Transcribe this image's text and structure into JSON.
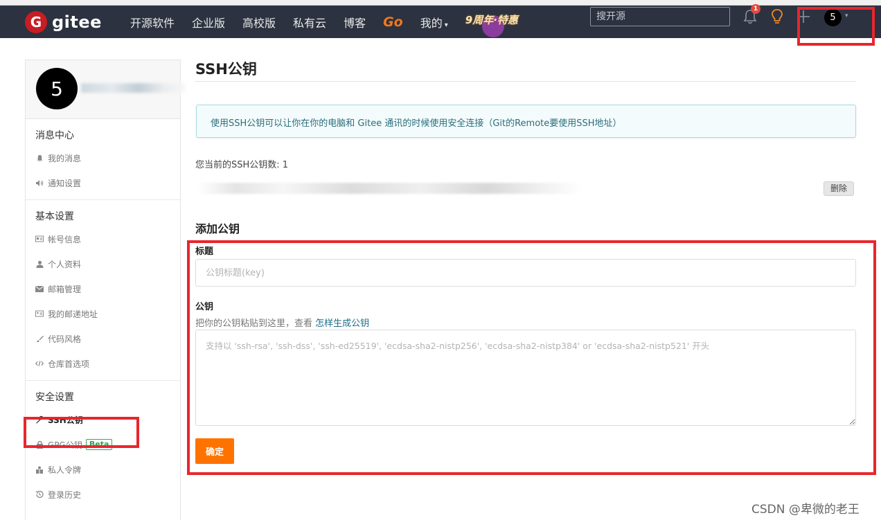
{
  "navbar": {
    "logo_letter": "G",
    "logo_text": "gitee",
    "items": [
      "开源软件",
      "企业版",
      "高校版",
      "私有云",
      "博客"
    ],
    "go_label": "Go",
    "mine_label": "我的",
    "mine_caret": "▾",
    "promo_text": "9周年·特惠",
    "search_placeholder": "搜开源",
    "notification_count": "1",
    "avatar_letter": "5",
    "avatar_caret": "▾"
  },
  "sidebar": {
    "avatar_letter": "5",
    "sections": [
      {
        "title": "消息中心",
        "items": [
          {
            "label": "我的消息",
            "icon": "bell-icon"
          },
          {
            "label": "通知设置",
            "icon": "speaker-icon"
          }
        ]
      },
      {
        "title": "基本设置",
        "items": [
          {
            "label": "帐号信息",
            "icon": "id-card-icon"
          },
          {
            "label": "个人资料",
            "icon": "user-icon"
          },
          {
            "label": "邮箱管理",
            "icon": "envelope-icon"
          },
          {
            "label": "我的邮递地址",
            "icon": "address-card-icon"
          },
          {
            "label": "代码风格",
            "icon": "paint-brush-icon"
          },
          {
            "label": "仓库首选项",
            "icon": "code-icon"
          }
        ]
      },
      {
        "title": "安全设置",
        "items": [
          {
            "label": "SSH公钥",
            "icon": "key-icon",
            "active": true
          },
          {
            "label": "GPG公钥",
            "icon": "lock-icon",
            "badge": "Beta"
          },
          {
            "label": "私人令牌",
            "icon": "token-icon"
          },
          {
            "label": "登录历史",
            "icon": "history-icon"
          }
        ]
      }
    ]
  },
  "main": {
    "title": "SSH公钥",
    "info": "使用SSH公钥可以让你在你的电脑和 Gitee 通讯的时候使用安全连接（Git的Remote要使用SSH地址）",
    "count_label": "您当前的SSH公钥数: 1",
    "delete_label": "删除",
    "add_title": "添加公钥",
    "form": {
      "title_label": "标题",
      "title_placeholder": "公钥标题(key)",
      "key_label": "公钥",
      "hint_prefix": "把你的公钥粘贴到这里，查看 ",
      "hint_link": "怎样生成公钥",
      "key_placeholder": "支持以 'ssh-rsa', 'ssh-dss', 'ssh-ed25519', 'ecdsa-sha2-nistp256', 'ecdsa-sha2-nistp384' or 'ecdsa-sha2-nistp521' 开头",
      "submit_label": "确定"
    }
  },
  "watermark": "CSDN @卑微的老王",
  "colors": {
    "navbar_bg": "#2c3240",
    "brand_red": "#c71d23",
    "accent_orange": "#fe7300",
    "annotation_red": "#e8262c",
    "info_text": "#2a6d7a"
  }
}
